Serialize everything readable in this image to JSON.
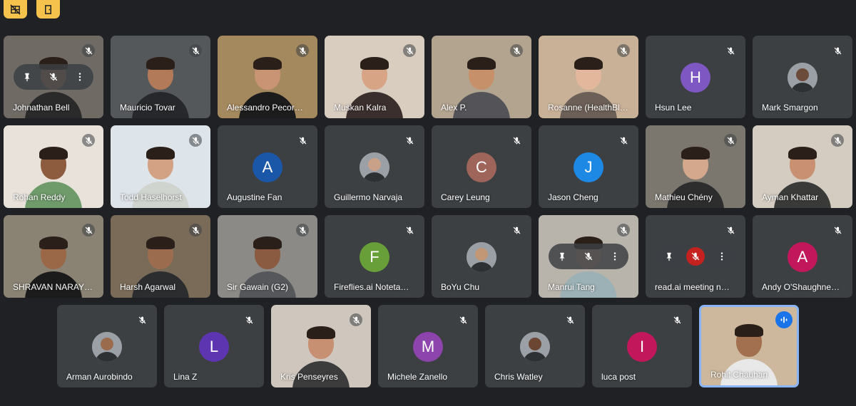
{
  "toolbar": {
    "icons": [
      "no-video-grid-icon",
      "door-exit-icon"
    ],
    "accent": "#f5c34b"
  },
  "colors": {
    "background": "#202124",
    "tile": "#3c4043",
    "speaking_border": "#8ab4f8"
  },
  "rows": [
    [
      {
        "name": "Johnathan Bell",
        "type": "video",
        "hover": true,
        "bg": "#6f6a64",
        "shirt": "#2a2a2a",
        "skin": "#c8916c"
      },
      {
        "name": "Mauricio Tovar",
        "type": "video",
        "bg": "#55585b",
        "shirt": "#26282b",
        "skin": "#b27a59"
      },
      {
        "name": "Alessandro Pecor…",
        "type": "video",
        "bg": "#a5895e",
        "shirt": "#1c1c1c",
        "skin": "#c99473"
      },
      {
        "name": "Muskan Kalra",
        "type": "video",
        "bg": "#d9cdbf",
        "shirt": "#3a2f2c",
        "skin": "#d7a486"
      },
      {
        "name": "Alex P.",
        "type": "video",
        "bg": "#b3a48f",
        "shirt": "#545458",
        "skin": "#c6906b"
      },
      {
        "name": "Rosanne (HealthBl…",
        "type": "video",
        "bg": "#c9b197",
        "shirt": "#6b5f57",
        "skin": "#e2b79c"
      },
      {
        "name": "Hsun Lee",
        "type": "initial",
        "initial": "H",
        "color": "#7e57c2"
      },
      {
        "name": "Mark Smargon",
        "type": "photo-avatar",
        "skin": "#6d4b3a"
      }
    ],
    [
      {
        "name": "Rohan Reddy",
        "type": "video",
        "bg": "#e8e2da",
        "shirt": "#6f9b6b",
        "skin": "#8d5b3e"
      },
      {
        "name": "Todd Haselhorst",
        "type": "video",
        "bg": "#dde4ea",
        "shirt": "#cfd4cf",
        "skin": "#d3a183"
      },
      {
        "name": "Augustine Fan",
        "type": "initial",
        "initial": "A",
        "color": "#1a57a8"
      },
      {
        "name": "Guillermo Narvaja",
        "type": "photo-avatar",
        "skin": "#c9a088"
      },
      {
        "name": "Carey Leung",
        "type": "initial",
        "initial": "C",
        "color": "#a0655a"
      },
      {
        "name": "Jason Cheng",
        "type": "initial",
        "initial": "J",
        "color": "#1e88e5"
      },
      {
        "name": "Mathieu Chény",
        "type": "video",
        "bg": "#7b776f",
        "shirt": "#2d2d2d",
        "skin": "#d3a88c"
      },
      {
        "name": "Ayman Khattar",
        "type": "video",
        "bg": "#d4ccc1",
        "shirt": "#3a3a38",
        "skin": "#c99172"
      }
    ],
    [
      {
        "name": "SHRAVAN NARAY…",
        "type": "video",
        "bg": "#8a8374",
        "shirt": "#1b1b1b",
        "skin": "#9a6747"
      },
      {
        "name": "Harsh Agarwal",
        "type": "video",
        "bg": "#7a6b58",
        "shirt": "#2b2d2f",
        "skin": "#9c6c4e"
      },
      {
        "name": "Sir Gawain (G2)",
        "type": "video",
        "bg": "#8b8a86",
        "shirt": "#55575a",
        "skin": "#8a5b41"
      },
      {
        "name": "Fireflies.ai Noteta…",
        "type": "initial",
        "initial": "F",
        "color": "#689f38"
      },
      {
        "name": "BoYu Chu",
        "type": "photo-avatar",
        "skin": "#c29775"
      },
      {
        "name": "Manrui Tang",
        "type": "video",
        "hover": true,
        "bg": "#b8b3ab",
        "shirt": "#9bb1b6",
        "skin": "#e0b99f"
      },
      {
        "name": "read.ai meeting n…",
        "type": "blank",
        "hover": true
      },
      {
        "name": "Andy O'Shaughne…",
        "type": "initial",
        "initial": "A",
        "color": "#c2185b"
      }
    ],
    [
      {
        "name": "Arman Aurobindo",
        "type": "photo-avatar",
        "skin": "#9a6b4c"
      },
      {
        "name": "Lina Z",
        "type": "initial",
        "initial": "L",
        "color": "#5e35b1"
      },
      {
        "name": "Kris Penseyres",
        "type": "video",
        "bg": "#cfc7bd",
        "shirt": "#3c3c3c",
        "skin": "#c79072"
      },
      {
        "name": "Michele Zanello",
        "type": "initial",
        "initial": "M",
        "color": "#8e44ad"
      },
      {
        "name": "Chris Watley",
        "type": "photo-avatar",
        "skin": "#6b4633"
      },
      {
        "name": "luca post",
        "type": "initial",
        "initial": "I",
        "color": "#c2185b"
      },
      {
        "name": "Rohit Chauhan",
        "type": "video",
        "speaking": true,
        "bg": "#cdb79d",
        "shirt": "#e8e8e8",
        "skin": "#a2704f"
      }
    ]
  ]
}
